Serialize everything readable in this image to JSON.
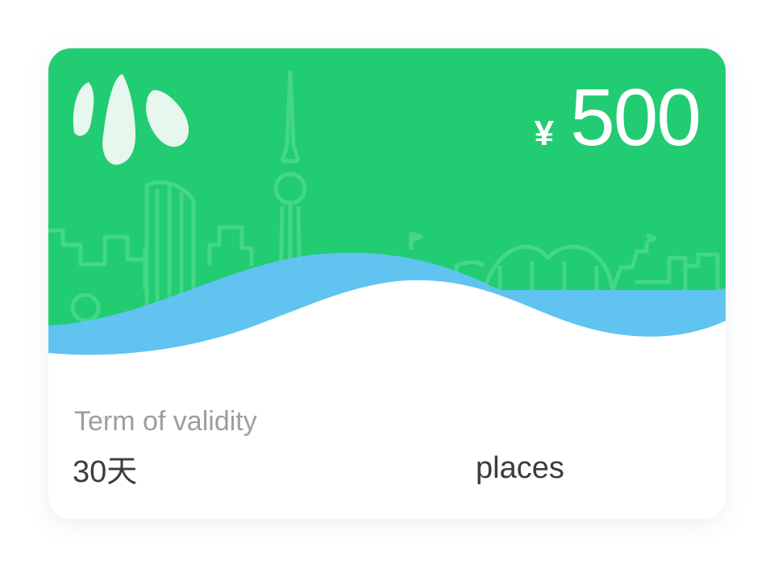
{
  "card": {
    "currency_symbol": "¥",
    "amount": "500",
    "validity_label": "Term of validity",
    "validity_value": "30天",
    "places_label": "places"
  },
  "colors": {
    "brand_green": "#22CC72",
    "wave_blue": "#66C2FB",
    "text_dark": "#3C3C3C",
    "text_muted": "#9E9E9E"
  },
  "icons": [
    "brand-logo-icon",
    "city-skyline-icon",
    "wave-decoration-icon"
  ]
}
